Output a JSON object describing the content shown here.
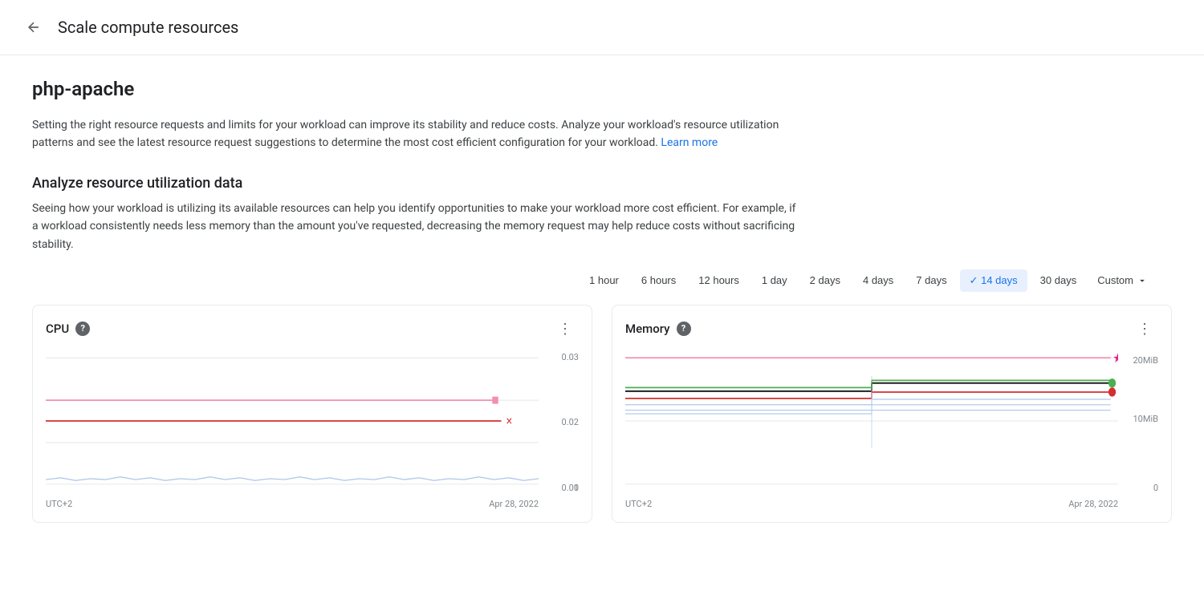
{
  "header": {
    "back_label": "←",
    "title": "Scale compute resources"
  },
  "workload": {
    "name": "php-apache"
  },
  "description": {
    "text": "Setting the right resource requests and limits for your workload can improve its stability and reduce costs. Analyze your workload's resource utilization patterns and see the latest resource request suggestions to determine the most cost efficient configuration for your workload.",
    "learn_more": "Learn more"
  },
  "analyze_section": {
    "title": "Analyze resource utilization data",
    "desc": "Seeing how your workload is utilizing its available resources can help you identify opportunities to make your workload more cost efficient. For example, if a workload consistently needs less memory than the amount you've requested, decreasing the memory request may help reduce costs without sacrificing stability."
  },
  "time_filters": [
    {
      "label": "1 hour",
      "key": "1h",
      "active": false
    },
    {
      "label": "6 hours",
      "key": "6h",
      "active": false
    },
    {
      "label": "12 hours",
      "key": "12h",
      "active": false
    },
    {
      "label": "1 day",
      "key": "1d",
      "active": false
    },
    {
      "label": "2 days",
      "key": "2d",
      "active": false
    },
    {
      "label": "4 days",
      "key": "4d",
      "active": false
    },
    {
      "label": "7 days",
      "key": "7d",
      "active": false
    },
    {
      "label": "14 days",
      "key": "14d",
      "active": true
    },
    {
      "label": "30 days",
      "key": "30d",
      "active": false
    }
  ],
  "custom_label": "Custom",
  "cpu_chart": {
    "title": "CPU",
    "help": "?",
    "y_labels": [
      "0.03",
      "0.02",
      "0.01",
      "0"
    ],
    "x_labels": [
      "UTC+2",
      "Apr 28, 2022"
    ],
    "more": "⋮"
  },
  "memory_chart": {
    "title": "Memory",
    "help": "?",
    "y_labels": [
      "20MiB",
      "10MiB",
      "0"
    ],
    "x_labels": [
      "UTC+2",
      "Apr 28, 2022"
    ],
    "more": "⋮"
  }
}
